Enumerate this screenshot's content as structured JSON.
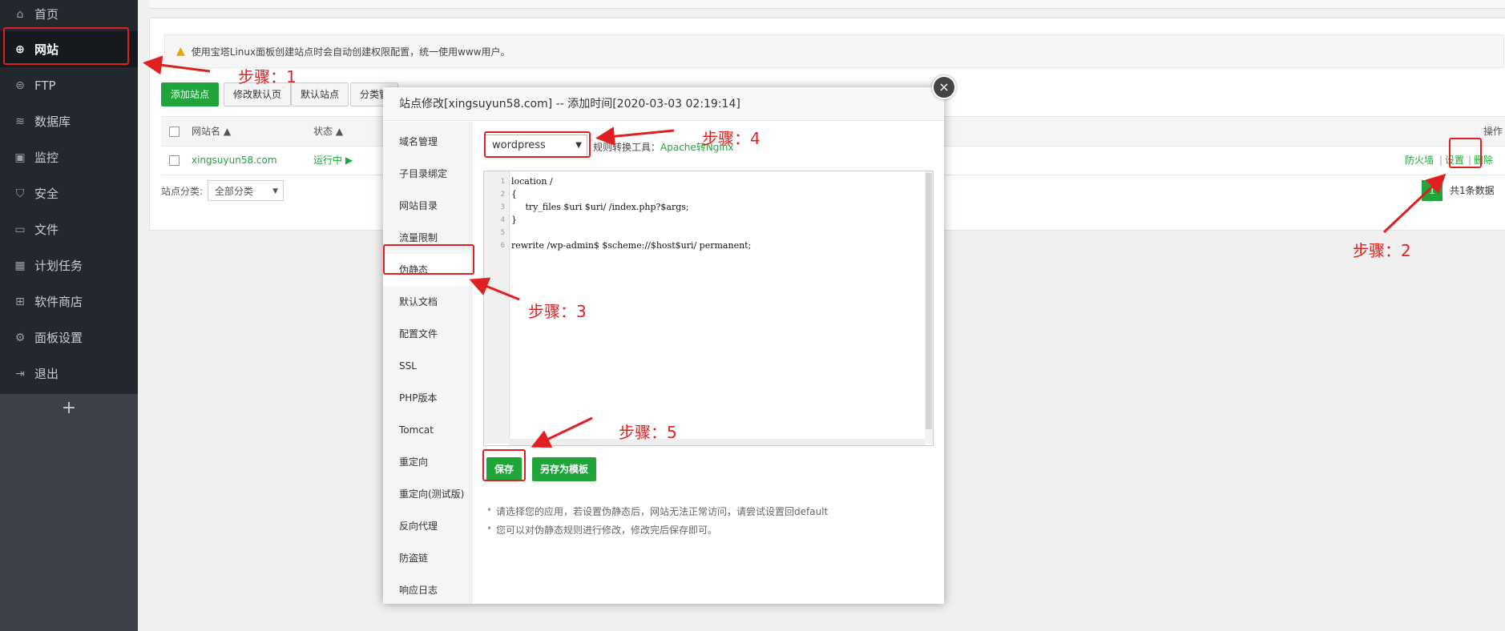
{
  "sidebar": {
    "items": [
      {
        "label": "首页",
        "icon": "home-icon"
      },
      {
        "label": "网站",
        "icon": "globe-icon"
      },
      {
        "label": "FTP",
        "icon": "ftp-icon"
      },
      {
        "label": "数据库",
        "icon": "database-icon"
      },
      {
        "label": "监控",
        "icon": "monitor-icon"
      },
      {
        "label": "安全",
        "icon": "shield-icon"
      },
      {
        "label": "文件",
        "icon": "folder-icon"
      },
      {
        "label": "计划任务",
        "icon": "calendar-icon"
      },
      {
        "label": "软件商店",
        "icon": "apps-icon"
      },
      {
        "label": "面板设置",
        "icon": "gear-icon"
      },
      {
        "label": "退出",
        "icon": "logout-icon"
      }
    ],
    "active": "网站",
    "add_label": "+"
  },
  "notice": "使用宝塔Linux面板创建站点时会自动创建权限配置，统一使用www用户。",
  "toolbar": {
    "add_site": "添加站点",
    "edit_default_page": "修改默认页",
    "default_site": "默认站点",
    "category": "分类管"
  },
  "table": {
    "headers": {
      "name": "网站名",
      "status": "状态",
      "actions": "操作"
    },
    "rows": [
      {
        "name": "xingsuyun58.com",
        "status": "运行中",
        "actions": [
          "防火墙",
          "设置",
          "删除"
        ],
        "separator": "|"
      }
    ]
  },
  "category_filter": {
    "label": "站点分类:",
    "value": "全部分类"
  },
  "pager": {
    "current": "1",
    "total": "共1条数据"
  },
  "modal": {
    "title": "站点修改[xingsuyun58.com] -- 添加时间[2020-03-03 02:19:14]",
    "close": "×",
    "nav": [
      "域名管理",
      "子目录绑定",
      "网站目录",
      "流量限制",
      "伪静态",
      "默认文档",
      "配置文件",
      "SSL",
      "PHP版本",
      "Tomcat",
      "重定向",
      "重定向(测试版)",
      "反向代理",
      "防盗链",
      "响应日志"
    ],
    "rule_select": "wordpress",
    "convert_label": "规则转换工具：",
    "convert_link": "Apache转Nginx",
    "code_lines": [
      {
        "n": "1",
        "text": "location /"
      },
      {
        "n": "2",
        "text": "{"
      },
      {
        "n": "3",
        "text": "     try_files $uri $uri/ /index.php?$args;"
      },
      {
        "n": "4",
        "text": "}"
      },
      {
        "n": "5",
        "text": ""
      },
      {
        "n": "6",
        "text": "rewrite /wp-admin$ $scheme://$host$uri/ permanent;"
      }
    ],
    "save_button": "保存",
    "save_template_button": "另存为模板",
    "tips": [
      "请选择您的应用，若设置伪静态后，网站无法正常访问，请尝试设置回default",
      "您可以对伪静态规则进行修改，修改完后保存即可。"
    ]
  },
  "annotations": {
    "step1": "步骤：1",
    "step2": "步骤：2",
    "step3": "步骤：3",
    "step4": "步骤：4",
    "step5": "步骤：5",
    "color": "#e02020"
  },
  "colors": {
    "accent": "#20a53a",
    "sidebar": "#23272e",
    "annotation": "#e02020"
  }
}
